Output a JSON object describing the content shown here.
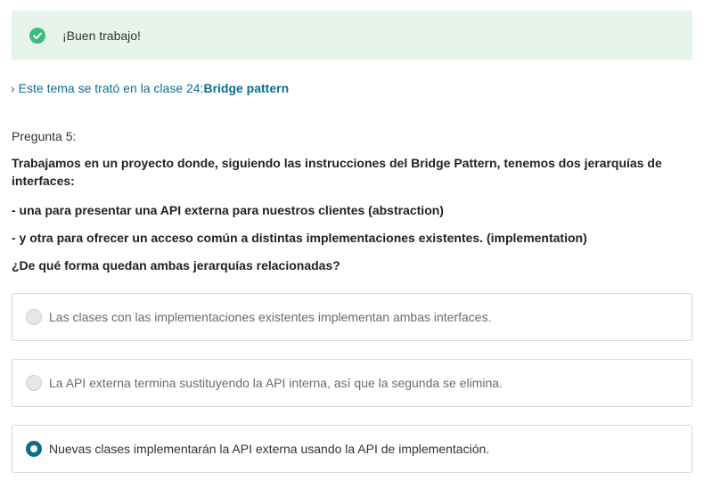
{
  "banner": {
    "message": "¡Buen trabajo!",
    "icon": "check-circle-icon",
    "color": "#3dbd7d",
    "background": "#e7f4ec"
  },
  "topic": {
    "chevron": "›",
    "prefix": "Este tema se trató en la clase 24:",
    "lesson": "Bridge pattern",
    "color": "#0c6e8f"
  },
  "question": {
    "number": "Pregunta 5:",
    "intro": "Trabajamos en un proyecto donde, siguiendo las instrucciones del Bridge Pattern, tenemos dos jerarquías de interfaces:",
    "item1": "- una para presentar una API externa para nuestros clientes (abstraction)",
    "item2": "- y otra para ofrecer un acceso común a distintas implementaciones existentes. (implementation)",
    "ask": "¿De qué forma quedan ambas jerarquías relacionadas?"
  },
  "options": [
    {
      "text": "Las clases con las implementaciones existentes implementan ambas interfaces.",
      "selected": false
    },
    {
      "text": "La API externa termina sustituyendo la API interna, así que la segunda se elimina.",
      "selected": false
    },
    {
      "text": "Nuevas clases implementarán la API externa usando la API de implementación.",
      "selected": true
    }
  ]
}
